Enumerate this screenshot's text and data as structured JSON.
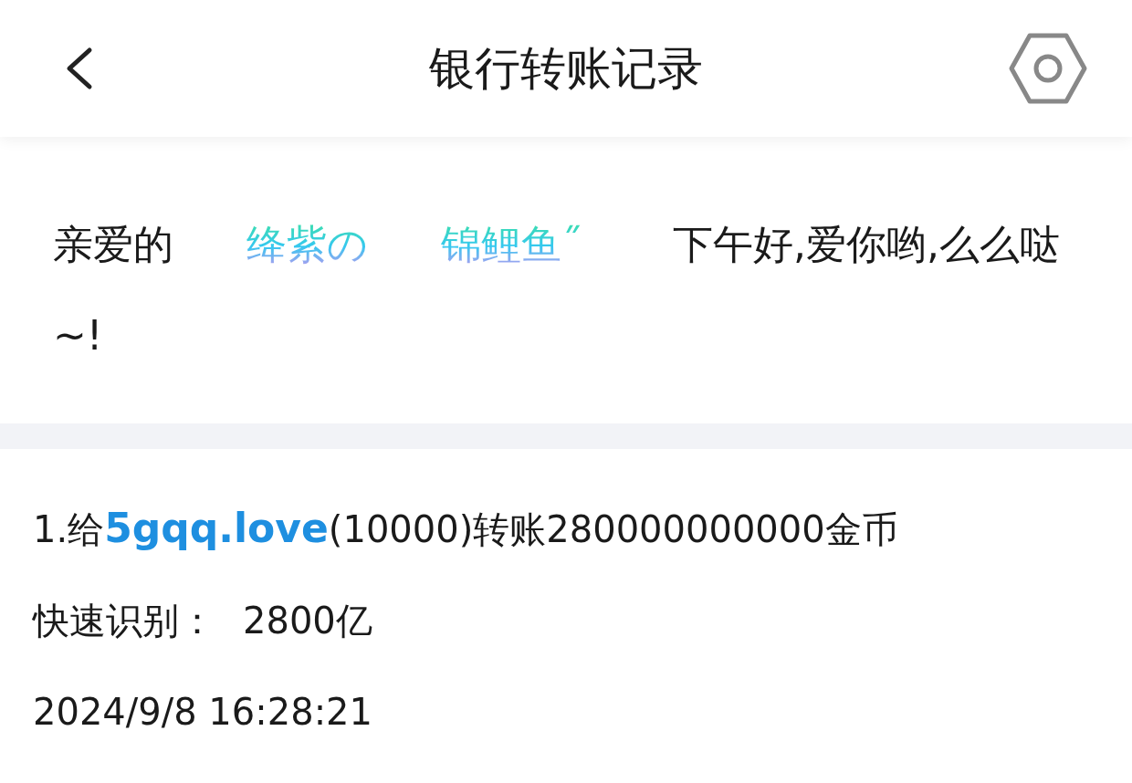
{
  "header": {
    "title": "银行转账记录"
  },
  "greeting": {
    "prefix": "亲爱的",
    "nickname": [
      "绛紫の",
      "锦鲤鱼˝"
    ],
    "suffix": "下午好,爱你哟,么么哒~!"
  },
  "records": [
    {
      "index": "1.给",
      "recipient": "5gqq.love",
      "detail": "(10000)转账280000000000金币",
      "quick_label": "快速识别：",
      "quick_value": "2800亿",
      "time": "2024/9/8 16:28:21"
    }
  ]
}
